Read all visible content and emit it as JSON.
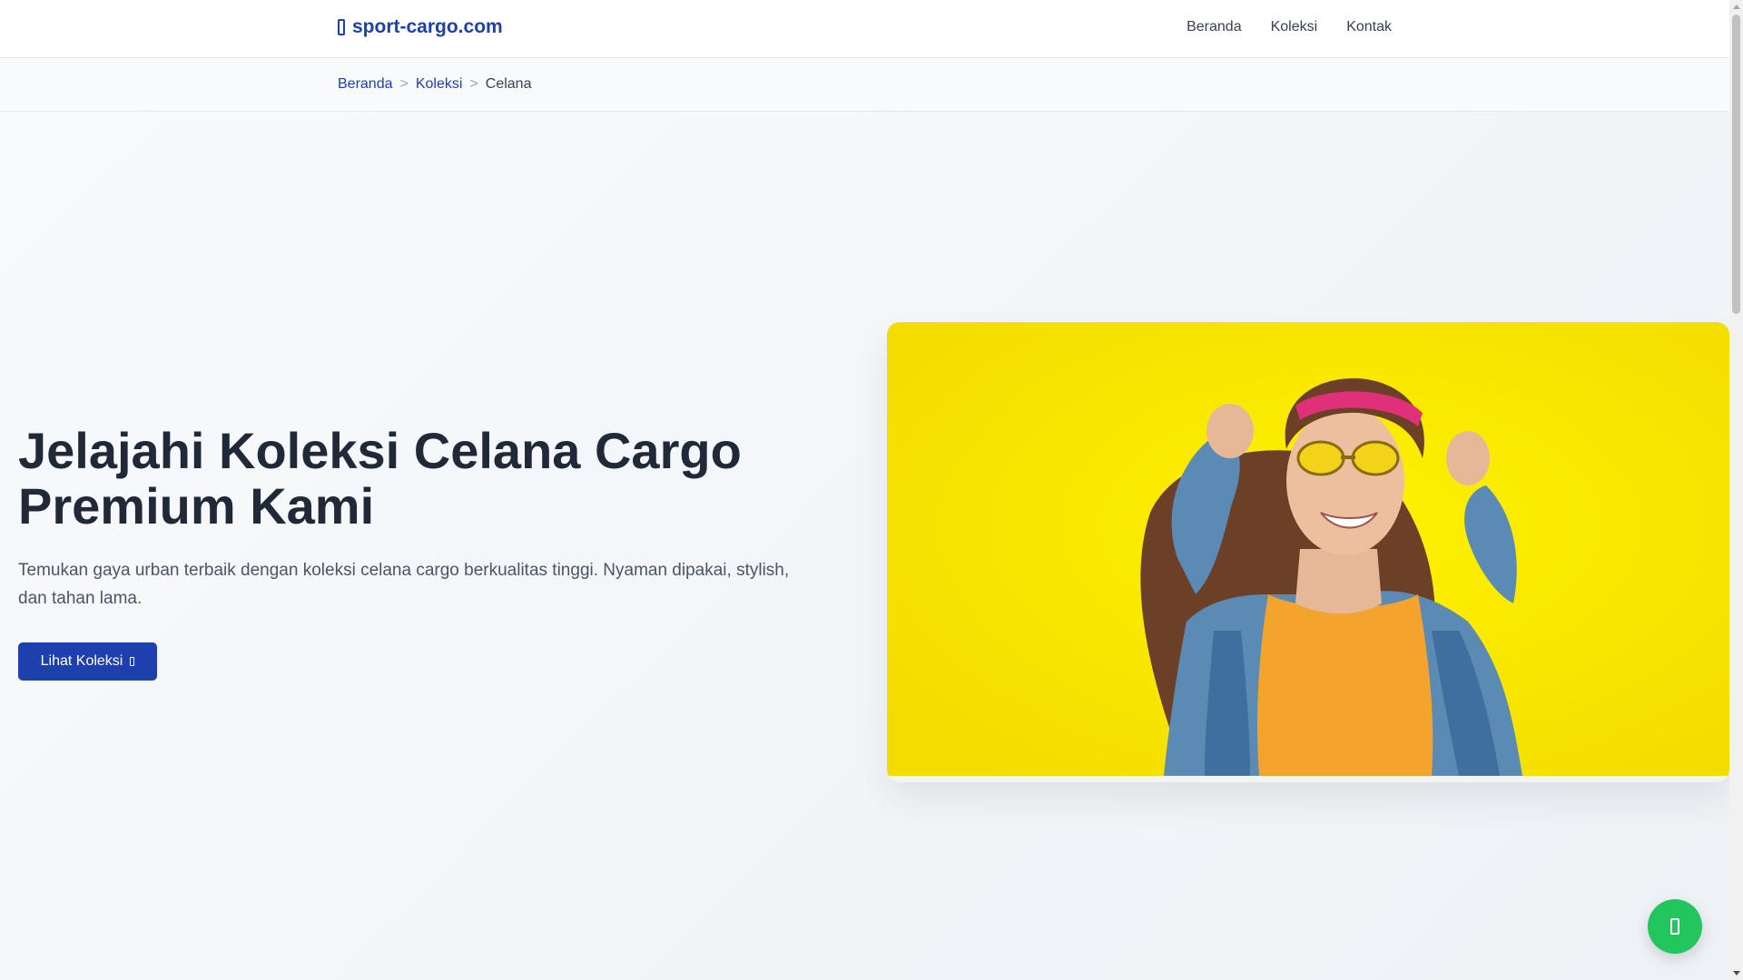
{
  "header": {
    "brand": "sport-cargo.com",
    "brand_icon": "box-icon",
    "nav": [
      {
        "label": "Beranda"
      },
      {
        "label": "Koleksi"
      },
      {
        "label": "Kontak"
      }
    ]
  },
  "breadcrumb": {
    "items": [
      {
        "label": "Beranda"
      },
      {
        "label": "Koleksi"
      }
    ],
    "separator": ">",
    "current": "Celana"
  },
  "hero": {
    "title": "Jelajahi Koleksi Celana Cargo Premium Kami",
    "subtitle": "Temukan gaya urban terbaik dengan koleksi celana cargo berkualitas tinggi. Nyaman dipakai, stylish, dan tahan lama.",
    "cta_label": "Lihat Koleksi",
    "cta_icon": "arrow-right-icon"
  },
  "floating": {
    "whatsapp_icon": "whatsapp-icon"
  },
  "colors": {
    "brand": "#1e40af",
    "whatsapp": "#22c55e",
    "hero_image_bg": "#f6e600"
  }
}
